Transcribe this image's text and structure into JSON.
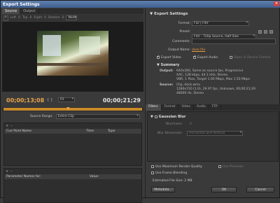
{
  "window": {
    "title": "Export Settings",
    "close_glyph": "×"
  },
  "left": {
    "tabs": [
      "Source",
      "Output"
    ],
    "tools": [
      "Left",
      "Top",
      "Right",
      "Bottom",
      "None"
    ],
    "tools_sub": [
      "0",
      "0",
      "0",
      "0"
    ],
    "timecode_current": "00;00;13;08",
    "timecode_end": "00;00;21;29",
    "fit": "Fit",
    "source_range_label": "Source Range:",
    "source_range_value": "Entire Clip",
    "cue": {
      "add": "+",
      "remove": "–",
      "col_name": "Cue Point Name",
      "col_time": "Time",
      "col_type": "Type"
    },
    "params": {
      "add": "+",
      "remove": "–",
      "col_name": "Parameter Names for:",
      "col_value": "Value"
    }
  },
  "right": {
    "export_settings_title": "Export Settings",
    "format_label": "Format:",
    "format_value": "FLV | F4V",
    "preset_label": "Preset:",
    "preset_value": "F4V - 720p Source, Half Size",
    "comments_label": "Comments:",
    "output_name_label": "Output Name:",
    "output_name_value": "deck.f4v",
    "export_video": "Export Video",
    "export_audio": "Export Audio",
    "open_device_central": "Open in Device Central",
    "summary_title": "Summary",
    "output_label": "Output:",
    "output_lines": [
      "640x360, Same as source fps, Progressive",
      "AAC, 128 kbps, 44.1 kHz, Stereo",
      "VBR, 1 Pass, Target 1.00 Mbps, Max 1.50 Mbps"
    ],
    "source_label": "Source:",
    "source_lines": [
      "Clip, deck.wmv",
      "1280x720 (1.0), 29.97 fps, Unknown, 00;00;21;29",
      "48000 Hz, Stereo"
    ],
    "filter_tabs": [
      "Filters",
      "Format",
      "Video",
      "Audio",
      "FTP"
    ],
    "gaussian_blur": "Gaussian Blur",
    "blurriness_label": "Blurriness:",
    "blurriness_value": "0",
    "blur_dimension_label": "Blur Dimension:",
    "blur_dimension_value": "Horizontal and Vertical",
    "use_max_render": "Use Maximum Render Quality",
    "use_previews": "Use Previews",
    "use_frame_blending": "Use Frame Blending",
    "estimated_size": "Estimated File Size: 2 MB",
    "metadata_button": "Metadata...",
    "ok_button": "OK",
    "cancel_button": "Cancel"
  },
  "colors": {
    "accent": "#e8a34a",
    "title_bar": "#4f6f9f"
  }
}
